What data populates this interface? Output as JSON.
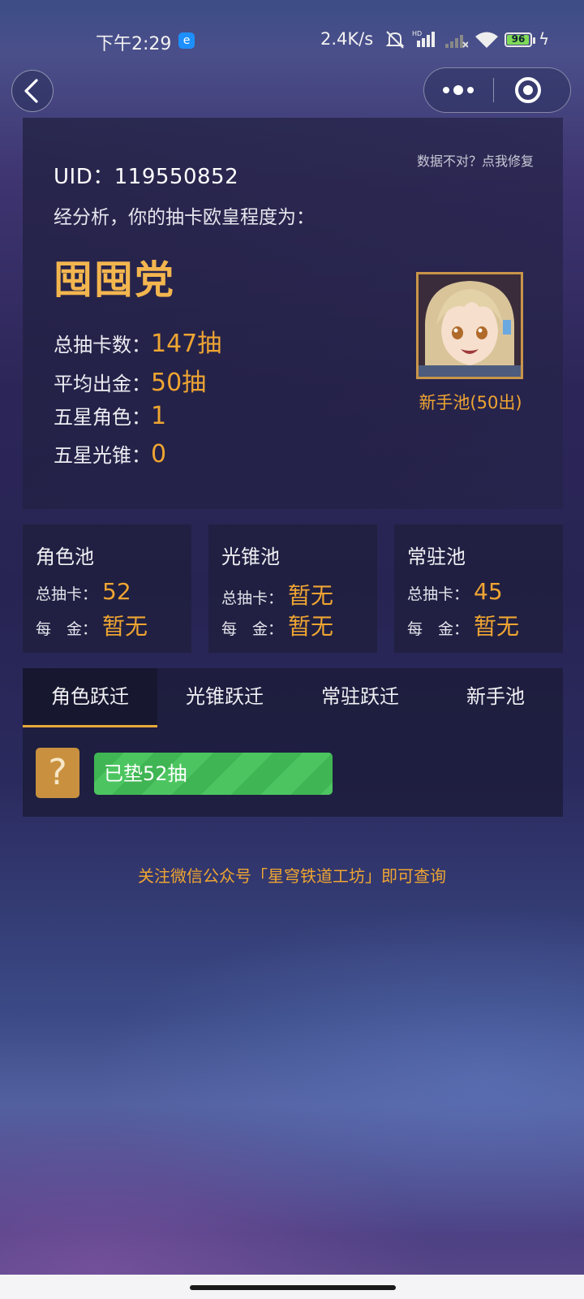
{
  "status_bar": {
    "time": "下午2:29",
    "app_badge": "e",
    "net_speed": "2.4K/s",
    "battery_percent": "96",
    "battery_level": 0.96
  },
  "nav": {
    "back_icon": "chevron-left-icon",
    "more_icon": "more-dots-icon",
    "close_icon": "target-circle-icon"
  },
  "summary": {
    "uid_label": "UID：",
    "uid_value": "119550852",
    "fix_link": "数据不对？点我修复",
    "analysis_text": "经分析，你的抽卡欧皇程度为：",
    "rank_title": "囤囤党",
    "stats": [
      {
        "label": "总抽卡数：",
        "value": "147抽"
      },
      {
        "label": "平均出金：",
        "value": "50抽"
      },
      {
        "label": "五星角色：",
        "value": "1"
      },
      {
        "label": "五星光锥：",
        "value": "0"
      }
    ],
    "avatar_caption": "新手池(50出)"
  },
  "pools": [
    {
      "name": "角色池",
      "total_label": "总抽卡：",
      "total_value": "52",
      "avg_label": "每　金：",
      "avg_value": "暂无"
    },
    {
      "name": "光锥池",
      "total_label": "总抽卡：",
      "total_value": "暂无",
      "avg_label": "每　金：",
      "avg_value": "暂无"
    },
    {
      "name": "常驻池",
      "total_label": "总抽卡：",
      "total_value": "45",
      "avg_label": "每　金：",
      "avg_value": "暂无"
    }
  ],
  "tabs": [
    {
      "label": "角色跃迁",
      "active": true
    },
    {
      "label": "光锥跃迁",
      "active": false
    },
    {
      "label": "常驻跃迁",
      "active": false
    },
    {
      "label": "新手池",
      "active": false
    }
  ],
  "pity": {
    "unknown_symbol": "?",
    "bar_text": "已垫52抽"
  },
  "footer_note": "关注微信公众号「星穹铁道工坊」即可查询",
  "colors": {
    "accent_gold": "#efa532",
    "rank_gold": "#f3b64f",
    "bar_green": "#3fb553"
  }
}
